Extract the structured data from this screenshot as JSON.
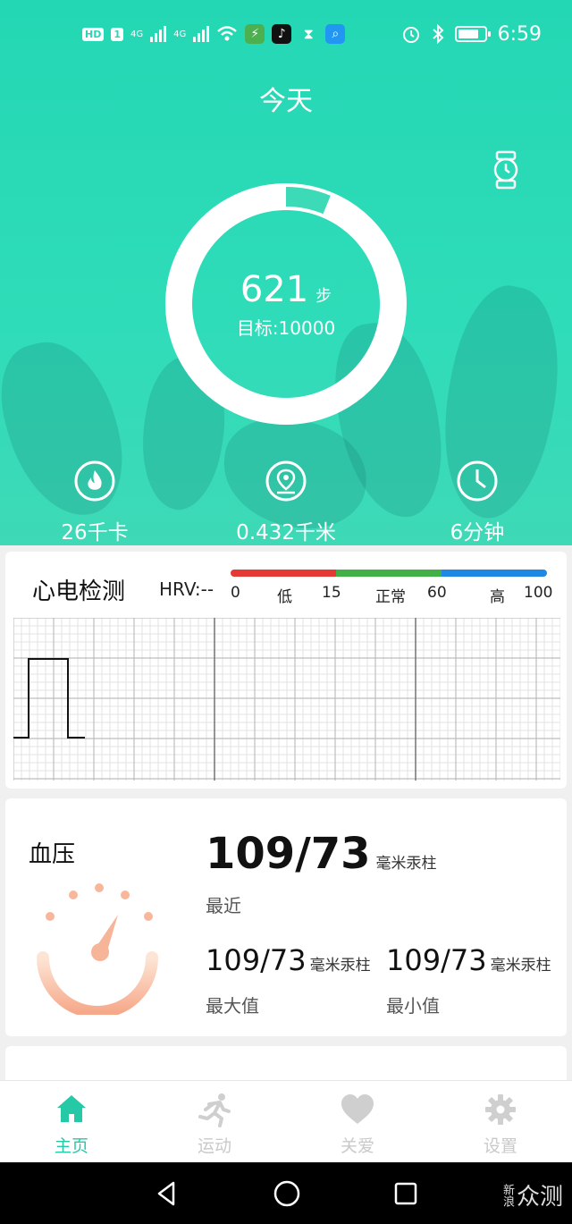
{
  "status_bar": {
    "left_badges": [
      "HD",
      "1",
      "4G",
      "4G"
    ],
    "time": "6:59"
  },
  "header": {
    "title": "今天"
  },
  "steps": {
    "value": "621",
    "unit": "步",
    "goal_text": "目标:10000",
    "progress": 0.0621
  },
  "stats": [
    {
      "icon": "flame-icon",
      "value": "26千卡"
    },
    {
      "icon": "location-pin-icon",
      "value": "0.432千米"
    },
    {
      "icon": "clock-icon",
      "value": "6分钟"
    }
  ],
  "ecg": {
    "title": "心电检测",
    "hrv": "HRV:--",
    "scale": {
      "colors": [
        "#e53935",
        "#43b047",
        "#1e88e5"
      ],
      "labels": [
        "0",
        "低",
        "15",
        "正常",
        "60",
        "高",
        "100"
      ]
    }
  },
  "blood_pressure": {
    "title": "血压",
    "recent_value": "109/73",
    "unit": "毫米汞柱",
    "recent_label": "最近",
    "max_value": "109/73",
    "max_label": "最大值",
    "min_value": "109/73",
    "min_label": "最小值"
  },
  "tabs": [
    {
      "label": "主页",
      "icon": "home-icon",
      "active": true
    },
    {
      "label": "运动",
      "icon": "running-icon",
      "active": false
    },
    {
      "label": "关爱",
      "icon": "heart-icon",
      "active": false
    },
    {
      "label": "设置",
      "icon": "gear-icon",
      "active": false
    }
  ],
  "colors": {
    "accent": "#25c9a6",
    "hero": "#2fdcb9"
  },
  "watermark": {
    "small": "新浪",
    "big": "众测"
  }
}
